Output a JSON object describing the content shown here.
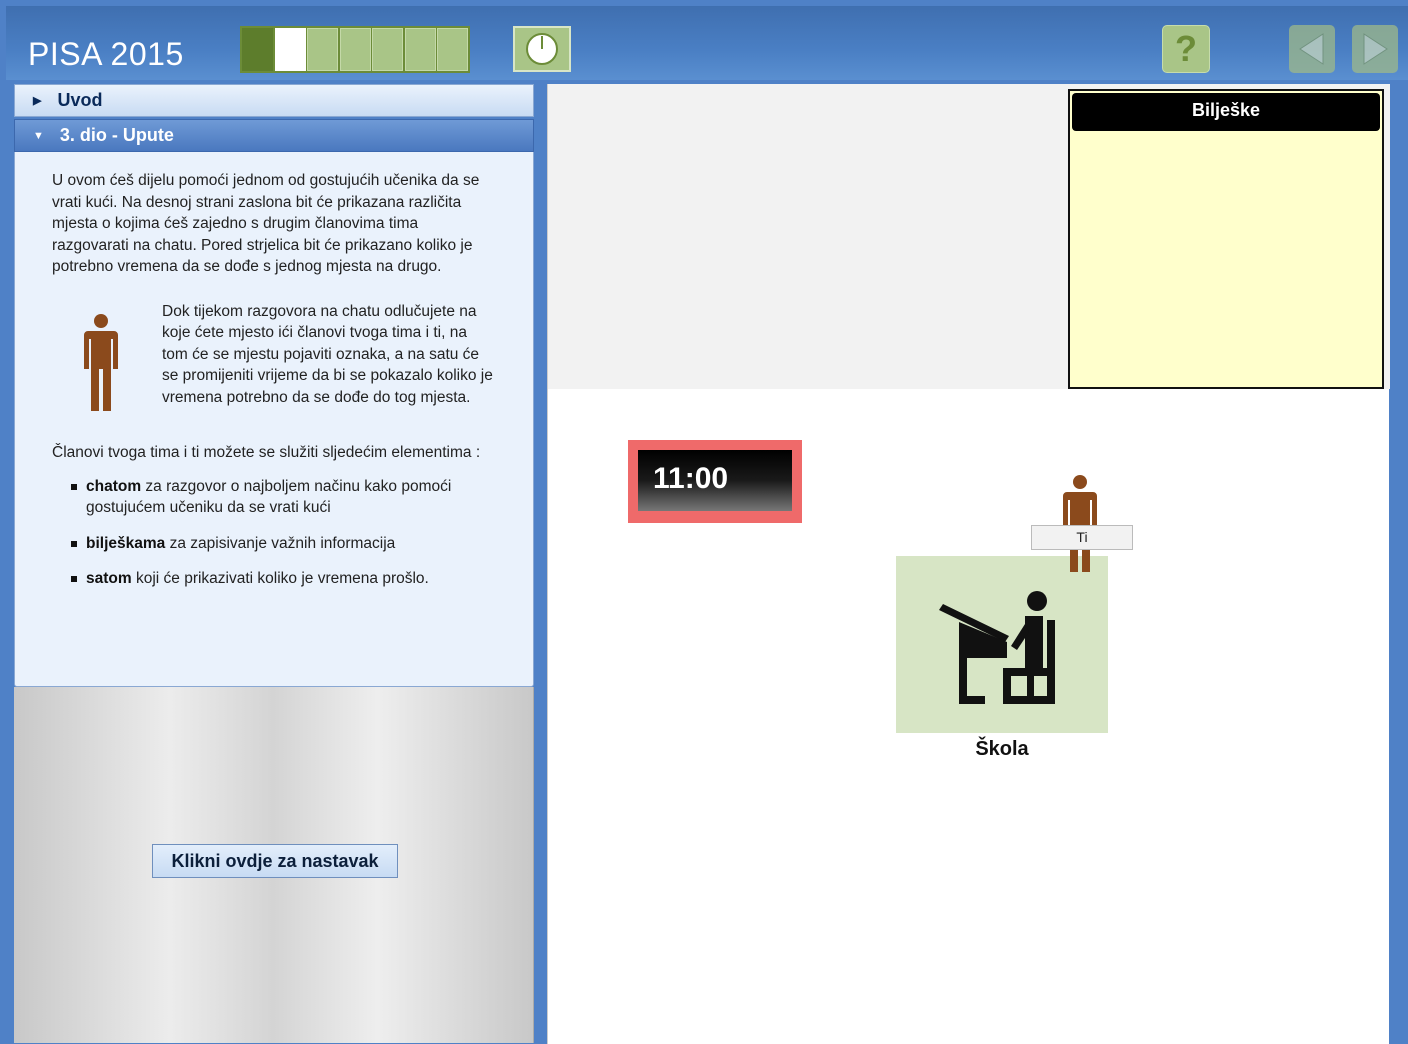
{
  "header": {
    "title": "PISA 2015",
    "progress": {
      "total": 7,
      "completed": 1,
      "current": 2
    },
    "timer_icon": "clock-icon",
    "help_label": "?",
    "nav": {
      "prev_icon": "arrow-left-icon",
      "next_icon": "arrow-right-icon"
    }
  },
  "sidebar": {
    "sections": [
      {
        "label": "Uvod",
        "expanded": false
      },
      {
        "label": "3. dio - Upute",
        "expanded": true
      }
    ],
    "intro": "U ovom ćeš dijelu pomoći jednom od gostujućih učenika da se vrati kući. Na desnoj strani zaslona bit će prikazana različita mjesta o kojima ćeš zajedno s drugim članovima tima razgovarati na chatu. Pored strjelica bit će prikazano koliko je potrebno vremena da se dođe s jednog mjesta na drugo.",
    "figure_text": "Dok tijekom razgovora na chatu odlučujete na koje ćete mjesto ići članovi tvoga tima i ti, na tom će se mjestu pojaviti oznaka, a na satu će se promijeniti vrijeme da bi se pokazalo koliko je vremena potrebno da se dođe do tog mjesta.",
    "tools_lead": "Članovi tvoga tima i ti možete se služiti sljedećim elementima :",
    "tools": [
      {
        "term": "chatom",
        "desc": " za razgovor o najboljem načinu kako pomoći gostujućem učeniku da se vrati kući"
      },
      {
        "term": "bilješkama",
        "desc": " za zapisivanje važnih informacija"
      },
      {
        "term": "satom",
        "desc": " koji će prikazivati koliko je vremena prošlo."
      }
    ],
    "continue_label": "Klikni ovdje za nastavak"
  },
  "main": {
    "notes_title": "Bilješke",
    "clock_time": "11:00",
    "location_name": "Škola",
    "player_tag": "Ti"
  },
  "colors": {
    "header_blue": "#4a7fc4",
    "progress_green": "#a9c587",
    "figure_brown": "#8b4a1c",
    "notes_yellow": "#ffffcc",
    "clock_red": "#ef6a6a",
    "school_green": "#d7e5c5"
  }
}
